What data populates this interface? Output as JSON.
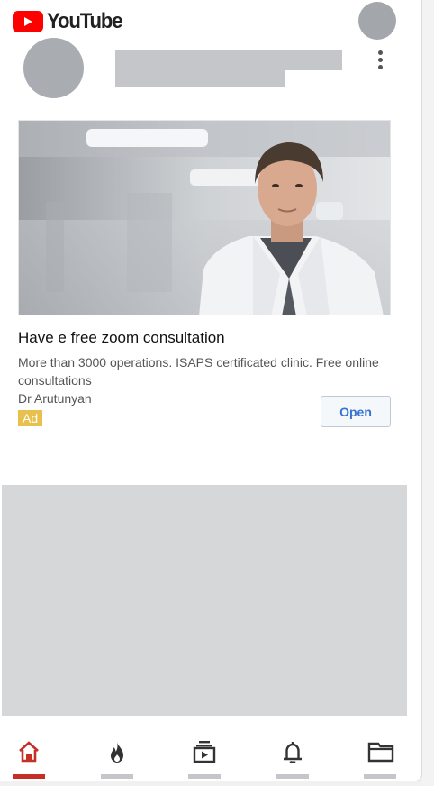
{
  "app": {
    "name": "YouTube",
    "brand_color": "#ff0000"
  },
  "header": {
    "logo_icon": "youtube-play-icon",
    "logo_text": "YouTube",
    "account_icon": "account-avatar"
  },
  "feed_item_placeholder": {
    "avatar": "channel-avatar-placeholder",
    "menu_icon": "more-vertical-icon"
  },
  "ad": {
    "title": "Have e free zoom consultation",
    "description": "More than 3000 operations. ISAPS certificated clinic. Free online consultations",
    "advertiser": "Dr Arutunyan",
    "badge": "Ad",
    "badge_color": "#e8c04e",
    "cta_label": "Open",
    "cta_color": "#3571d6"
  },
  "bottom_nav": {
    "items": [
      {
        "icon": "home-icon",
        "active": true
      },
      {
        "icon": "trending-flame-icon",
        "active": false
      },
      {
        "icon": "subscriptions-icon",
        "active": false
      },
      {
        "icon": "notifications-bell-icon",
        "active": false
      },
      {
        "icon": "library-folder-icon",
        "active": false
      }
    ],
    "active_color": "#c62f25"
  }
}
